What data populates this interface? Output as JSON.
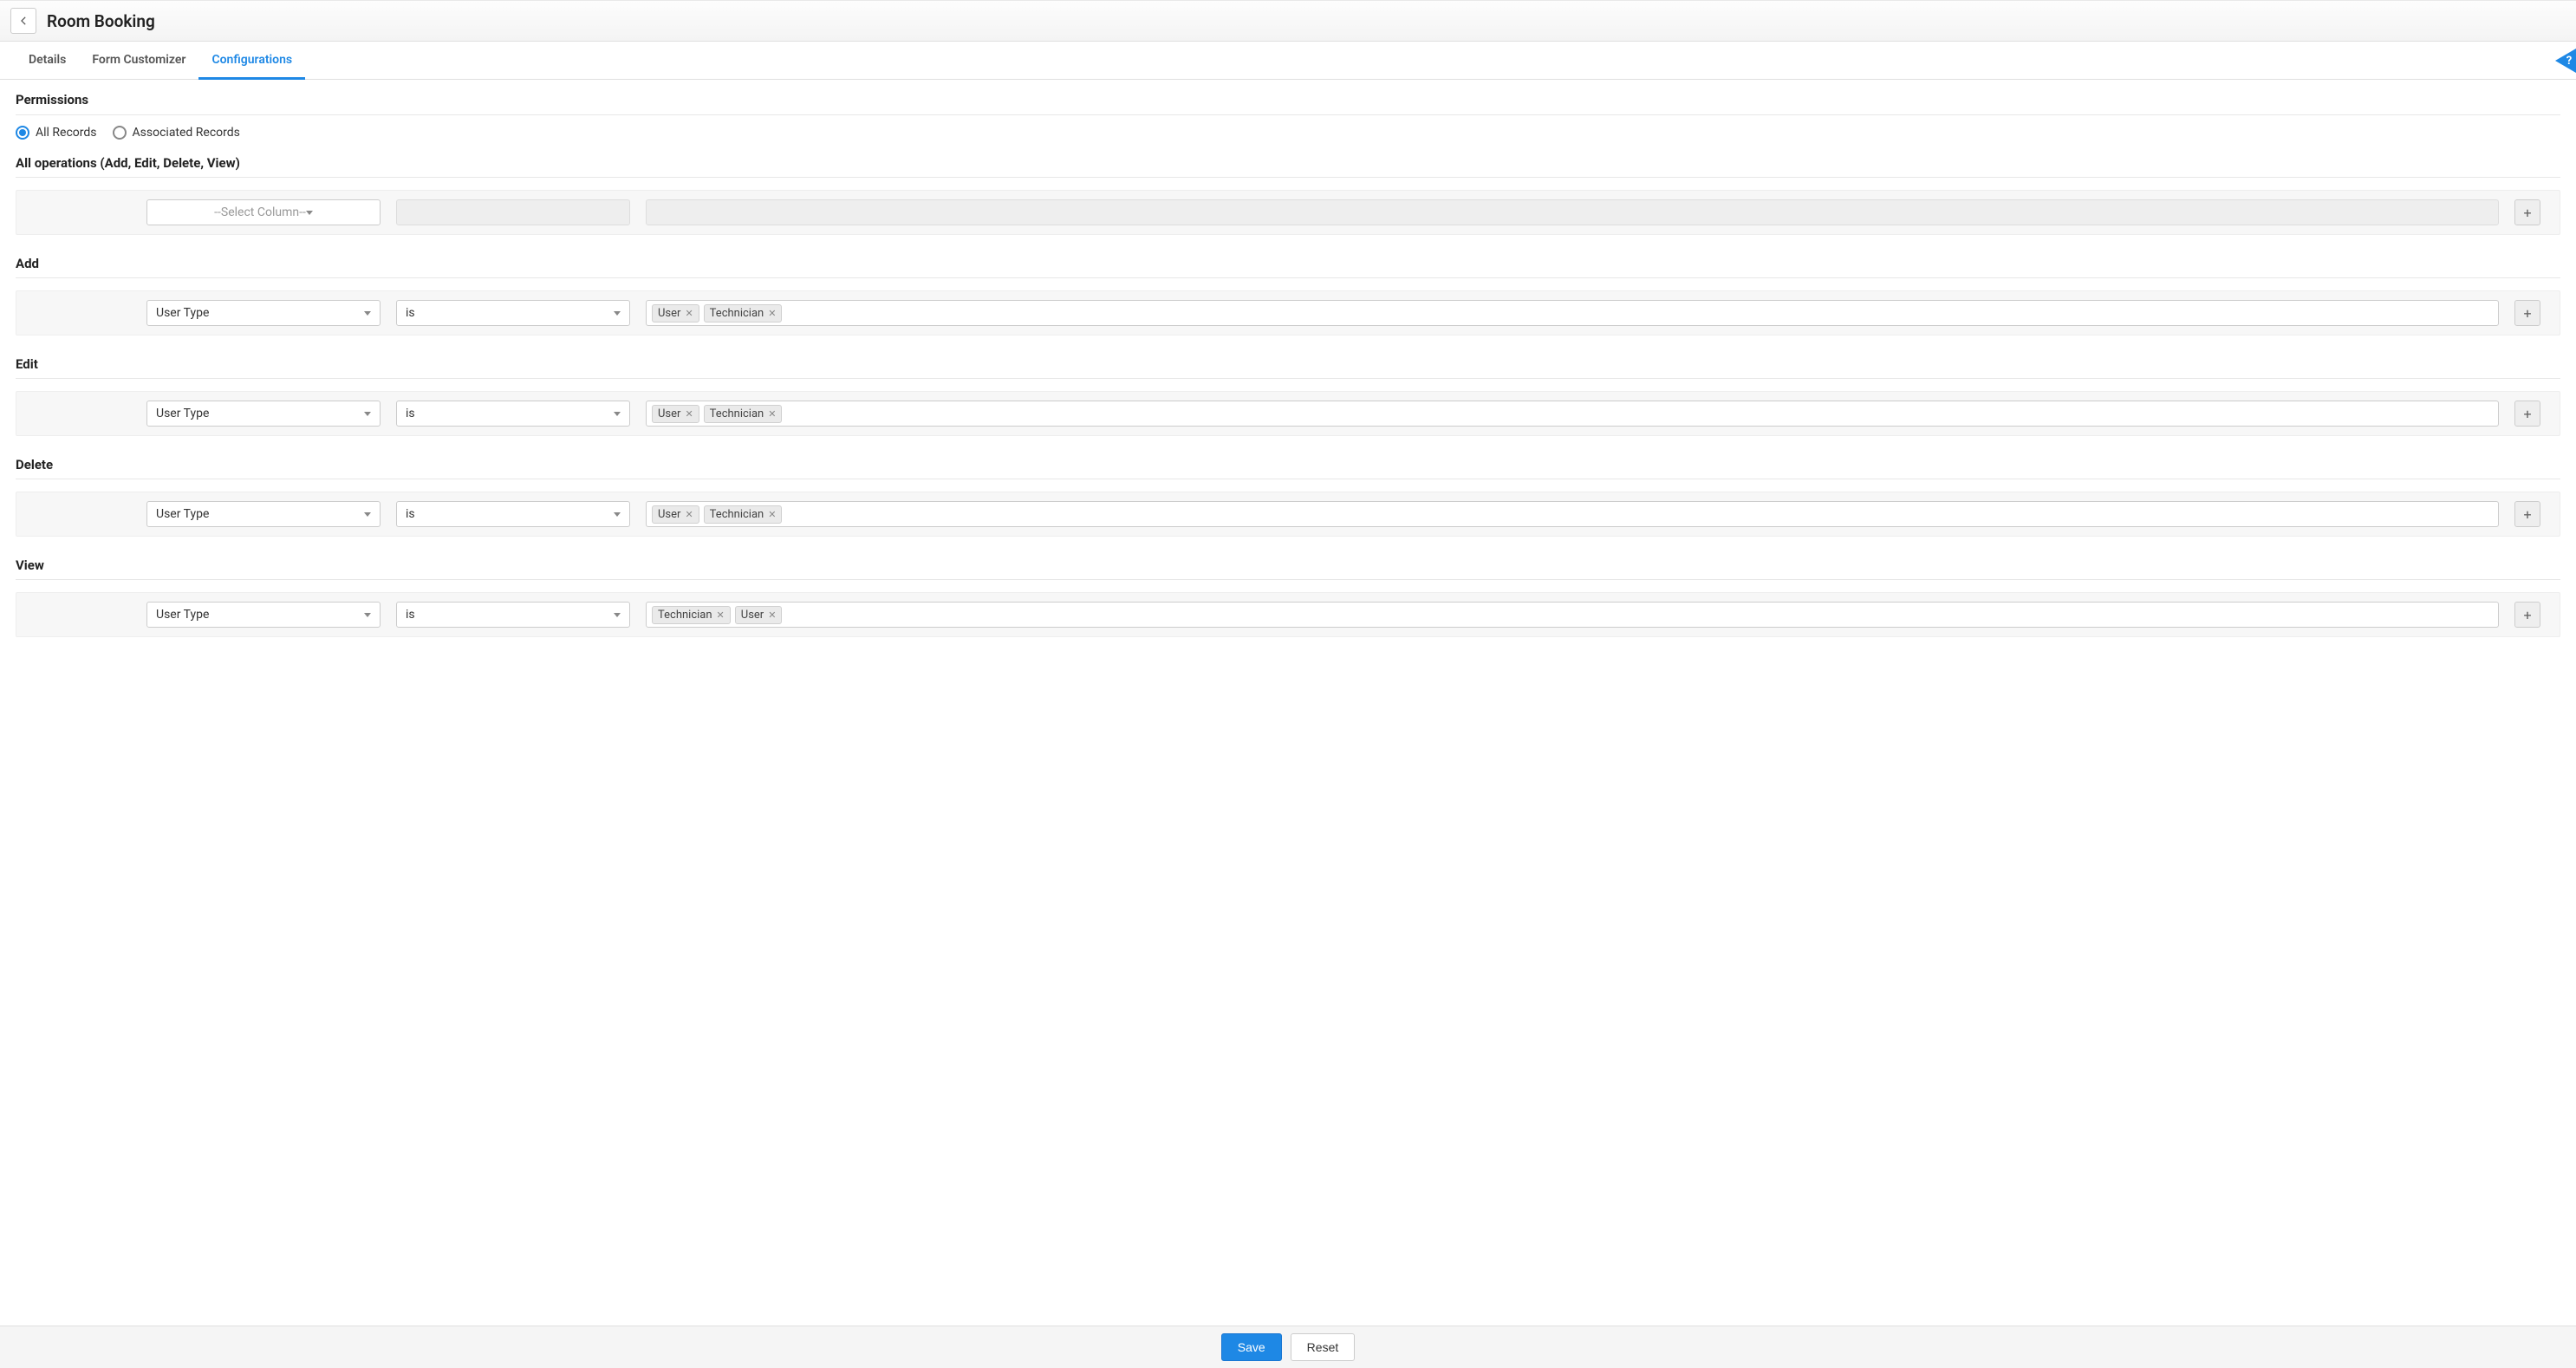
{
  "header": {
    "title": "Room Booking"
  },
  "tabs": {
    "items": [
      {
        "label": "Details",
        "active": false
      },
      {
        "label": "Form Customizer",
        "active": false
      },
      {
        "label": "Configurations",
        "active": true
      }
    ],
    "help_label": "?"
  },
  "permissions": {
    "heading": "Permissions",
    "radios": {
      "all_records": "All Records",
      "associated_records": "Associated Records",
      "selected": "all_records"
    }
  },
  "operations": [
    {
      "title": "All operations (Add, Edit, Delete, View)",
      "column": {
        "value": "",
        "placeholder": "--Select Column--",
        "disabled": false
      },
      "operator": {
        "value": "",
        "disabled": true
      },
      "tags": {
        "values": [],
        "disabled": true
      }
    },
    {
      "title": "Add",
      "column": {
        "value": "User Type",
        "disabled": false
      },
      "operator": {
        "value": "is",
        "disabled": false
      },
      "tags": {
        "values": [
          "User",
          "Technician"
        ],
        "disabled": false
      }
    },
    {
      "title": "Edit",
      "column": {
        "value": "User Type",
        "disabled": false
      },
      "operator": {
        "value": "is",
        "disabled": false
      },
      "tags": {
        "values": [
          "User",
          "Technician"
        ],
        "disabled": false
      }
    },
    {
      "title": "Delete",
      "column": {
        "value": "User Type",
        "disabled": false
      },
      "operator": {
        "value": "is",
        "disabled": false
      },
      "tags": {
        "values": [
          "User",
          "Technician"
        ],
        "disabled": false
      }
    },
    {
      "title": "View",
      "column": {
        "value": "User Type",
        "disabled": false
      },
      "operator": {
        "value": "is",
        "disabled": false
      },
      "tags": {
        "values": [
          "Technician",
          "User"
        ],
        "disabled": false
      }
    }
  ],
  "footer": {
    "save_label": "Save",
    "reset_label": "Reset"
  }
}
